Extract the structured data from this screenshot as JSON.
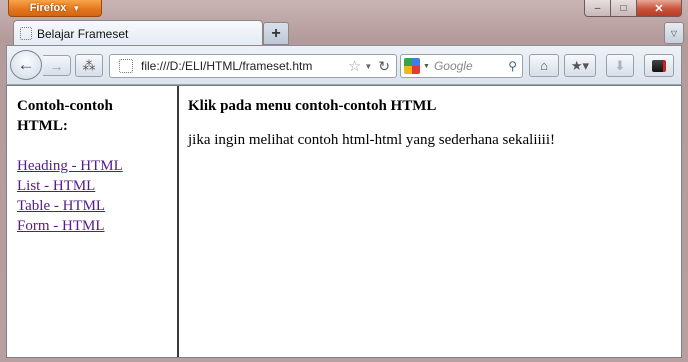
{
  "window": {
    "app_button_label": "Firefox",
    "controls": {
      "minimize": "–",
      "maximize": "□",
      "close": "✕"
    }
  },
  "tabs": [
    {
      "label": "Belajar Frameset",
      "active": true
    }
  ],
  "toolbar": {
    "url": "file:///D:/ELI/HTML/frameset.htm",
    "search_placeholder": "Google"
  },
  "left_frame": {
    "heading": "Contoh-contoh HTML:",
    "links": [
      "Heading - HTML",
      "List - HTML",
      "Table - HTML",
      "Form - HTML"
    ]
  },
  "right_frame": {
    "heading": "Klik pada menu contoh-contoh HTML",
    "text": "jika ingin melihat contoh html-html yang sederhana sekaliiii!"
  },
  "colors": {
    "firefox_orange": "#e2751c",
    "visited_link": "#551a8b",
    "close_red": "#c9523a"
  }
}
